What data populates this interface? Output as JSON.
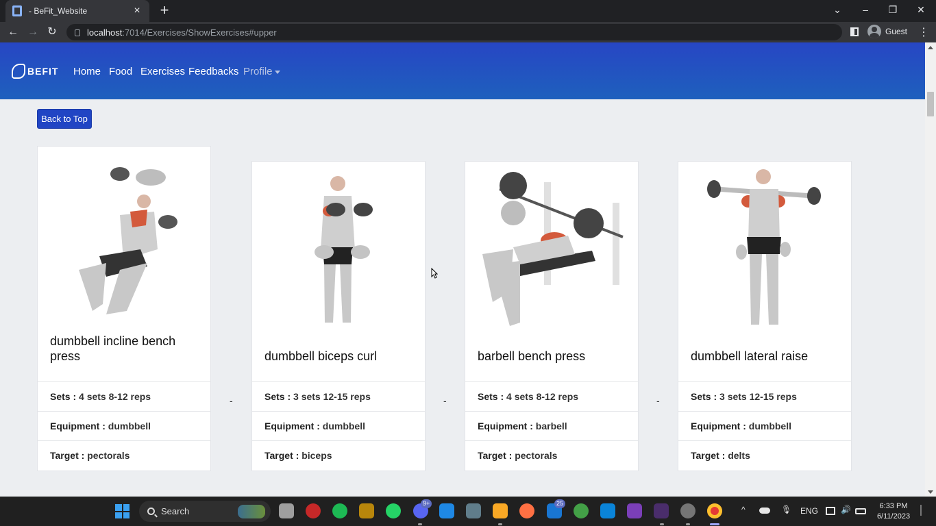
{
  "browser": {
    "tab_title": "- BeFit_Website",
    "url_host": "localhost",
    "url_path": ":7014/Exercises/ShowExercises#upper",
    "profile_label": "Guest"
  },
  "navbar": {
    "brand": "BEFIT",
    "links": [
      "Home",
      "Food",
      "Exercises",
      "Feedbacks"
    ],
    "profile_label": "Profile"
  },
  "page": {
    "back_to_top_label": "Back to Top",
    "separator": "-",
    "sets_label": "Sets :",
    "equipment_label": "Equipment :",
    "target_label": "Target :",
    "exercises": [
      {
        "name": "dumbbell incline bench press",
        "sets": "4 sets 8-12 reps",
        "equipment": "dumbbell",
        "target": "pectorals"
      },
      {
        "name": "dumbbell biceps curl",
        "sets": "3 sets 12-15 reps",
        "equipment": "dumbbell",
        "target": "biceps"
      },
      {
        "name": "barbell bench press",
        "sets": "4 sets 8-12 reps",
        "equipment": "barbell",
        "target": "pectorals"
      },
      {
        "name": "dumbbell lateral raise",
        "sets": "3 sets 12-15 reps",
        "equipment": "dumbbell",
        "target": "delts"
      }
    ]
  },
  "taskbar": {
    "search_label": "Search",
    "discord_badge": "9+",
    "mail_badge": "25",
    "lang": "ENG",
    "time": "6:33 PM",
    "date": "6/11/2023"
  },
  "colors": {
    "navbar_top": "#2746c4",
    "navbar_bottom": "#1e60bd",
    "button_blue": "#2145c4",
    "page_bg": "#eceef1"
  }
}
